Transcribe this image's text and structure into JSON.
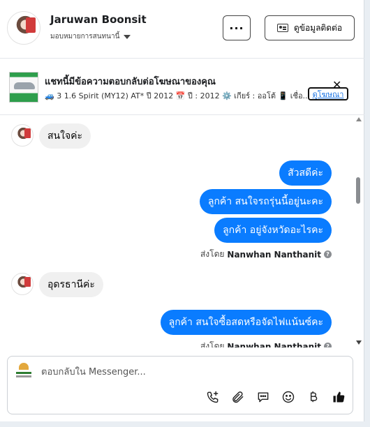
{
  "header": {
    "contact_name": "Jaruwan Boonsit",
    "assign_label": "มอบหมายการสนทนานี้",
    "more_label": "···",
    "contact_info_label": "ดูข้อมูลติดต่อ"
  },
  "ad": {
    "title": "แชทนี้มีข้อความตอบกลับต่อโฆษณาของคุณ",
    "detail": "🚙 3 1.6 Spirit (MY12) AT* ปี 2012 📅 ปี : 2012 ⚙️ เกียร์ : ออโต้ 📱 เชื่อ...",
    "link_label": "ดูโฆษณา",
    "close_label": "✕"
  },
  "messages": {
    "m1": "สนใจค่ะ",
    "m2": "สัวสดีค่ะ",
    "m3": "ลูกค้า  สนใจรถรุ่นนี้อยู่นะคะ",
    "m4": "ลูกค้า อยู่จังหวัดอะไรคะ",
    "sent1_prefix": "ส่งโดย",
    "sent1_name": "Nanwhan Nanthanit",
    "m5": "อุดรธานีค่ะ",
    "m6": "ลูกค้า สนใจซื้อสดหรือจัดไฟแน้นซ์คะ",
    "sent2_prefix": "ส่งโดย",
    "sent2_name": "Nanwhan Nanthanit"
  },
  "composer": {
    "placeholder": "ตอบกลับใน Messenger...",
    "tools": [
      "call-add-icon",
      "paperclip-icon",
      "saved-replies-icon",
      "emoji-icon",
      "baht-icon",
      "thumbs-up-icon"
    ]
  },
  "colors": {
    "outgoing_bubble": "#0a7cff",
    "incoming_bubble": "#f0f0f0",
    "link": "#1b74e4"
  }
}
